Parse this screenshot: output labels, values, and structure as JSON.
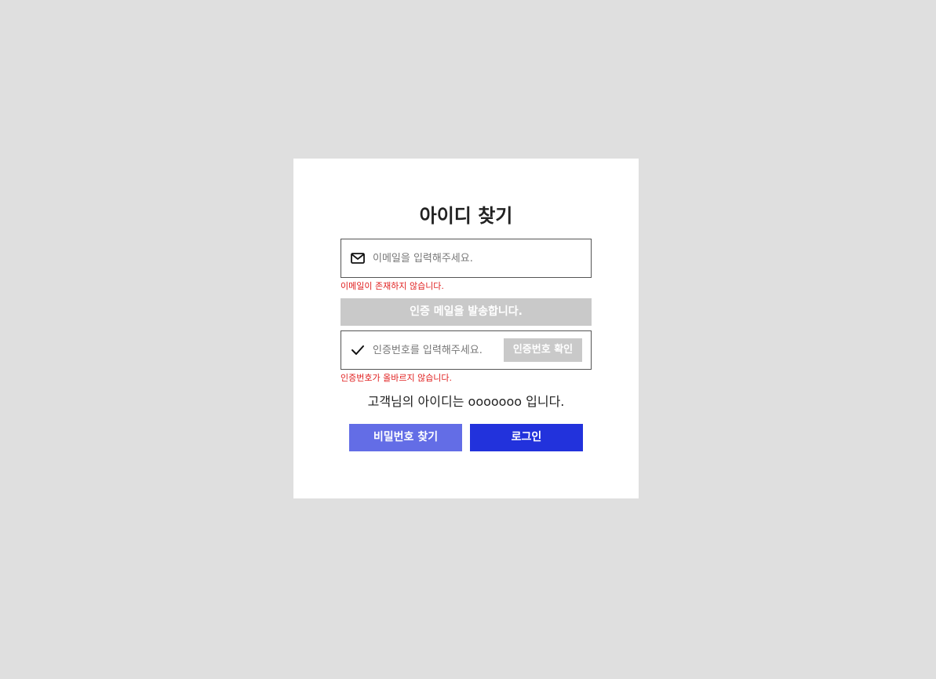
{
  "title": "아이디 찾기",
  "email": {
    "placeholder": "이메일을 입력해주세요.",
    "value": "",
    "icon": "mail-icon",
    "error": "이메일이 존재하지 않습니다."
  },
  "send_button": {
    "label": "인증 메일을 발송합니다."
  },
  "code": {
    "placeholder": "인증번호를 입력해주세요.",
    "value": "",
    "icon": "checkmark-icon",
    "verify_label": "인증번호 확인",
    "error": "인증번호가 올바르지 않습니다."
  },
  "result_text": "고객님의 아이디는 ooooooo 입니다.",
  "buttons": {
    "find_password": "비밀번호 찾기",
    "login": "로그인"
  },
  "colors": {
    "page_background": "#dfdfdf",
    "card_background": "#ffffff",
    "disabled_button": "#c9c9c9",
    "error_text": "#e01e1e",
    "find_password_button": "#636de6",
    "login_button": "#2232dc"
  }
}
